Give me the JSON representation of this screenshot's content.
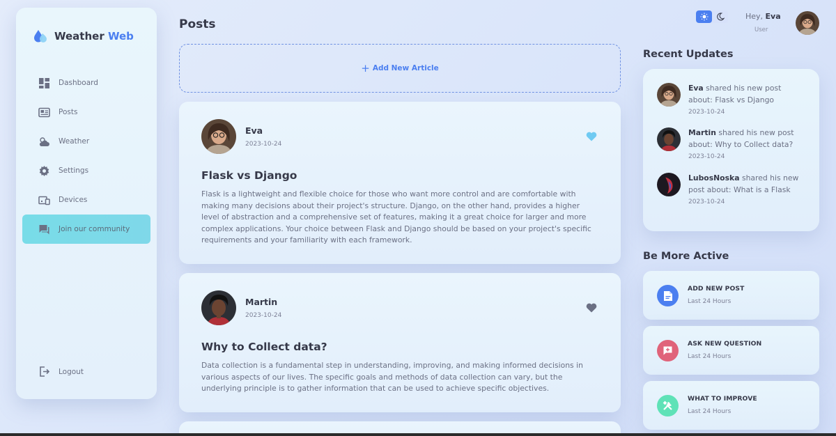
{
  "sidebar": {
    "logo": {
      "part1": "Weather",
      "part2": "Web"
    },
    "items": [
      {
        "label": "Dashboard",
        "icon": "dashboard-icon"
      },
      {
        "label": "Posts",
        "icon": "newspaper-icon"
      },
      {
        "label": "Weather",
        "icon": "cloud-sun-icon"
      },
      {
        "label": "Settings",
        "icon": "gear-icon"
      },
      {
        "label": "Devices",
        "icon": "devices-icon"
      },
      {
        "label": "Join our community",
        "icon": "chat-icon",
        "active": true
      }
    ],
    "logout": "Logout"
  },
  "main": {
    "title": "Posts",
    "add_article": "Add New Article",
    "posts": [
      {
        "author": "Eva",
        "date": "2023-10-24",
        "title": "Flask vs Django",
        "body": "Flask is a lightweight and flexible choice for those who want more control and are comfortable with making many decisions about their project's structure. Django, on the other hand, provides a higher level of abstraction and a comprehensive set of features, making it a great choice for larger and more complex applications. Your choice between Flask and Django should be based on your project's specific requirements and your familiarity with each framework.",
        "liked": true
      },
      {
        "author": "Martin",
        "date": "2023-10-24",
        "title": "Why to Collect data?",
        "body": "Data collection is a fundamental step in understanding, improving, and making informed decisions in various aspects of our lives. The specific goals and methods of data collection can vary, but the underlying principle is to gather information that can be used to achieve specific objectives.",
        "liked": false
      }
    ]
  },
  "header": {
    "greeting": "Hey,",
    "user_name": "Eva",
    "role": "User"
  },
  "recent_updates": {
    "title": "Recent Updates",
    "items": [
      {
        "name": "Eva",
        "text": "shared his new post about: Flask vs Django",
        "date": "2023-10-24"
      },
      {
        "name": "Martin",
        "text": "shared his new post about: Why to Collect data?",
        "date": "2023-10-24"
      },
      {
        "name": "LubosNoska",
        "text": "shared his new post about: What is a Flask",
        "date": "2023-10-24"
      }
    ]
  },
  "be_active": {
    "title": "Be More Active",
    "items": [
      {
        "label": "ADD NEW POST",
        "sub": "Last 24 Hours",
        "icon": "add-post-icon",
        "color": "#4b7ff0"
      },
      {
        "label": "ASK NEW QUESTION",
        "sub": "Last 24 Hours",
        "icon": "question-icon",
        "color": "#e0637a"
      },
      {
        "label": "WHAT TO IMPROVE",
        "sub": "Last 24 Hours",
        "icon": "tools-icon",
        "color": "#5fe2b7"
      }
    ]
  },
  "colors": {
    "accent": "#4b7ff0",
    "active_nav": "#78dce8",
    "heart_liked": "#6fcaf2",
    "heart_default": "#6b7084"
  }
}
